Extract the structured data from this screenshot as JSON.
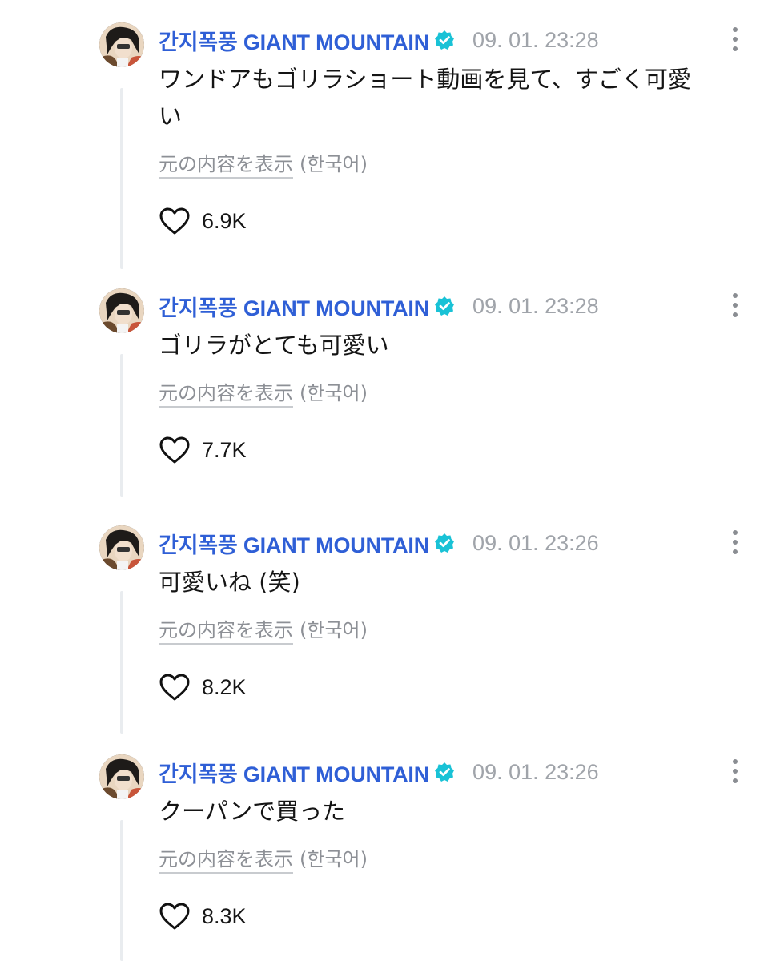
{
  "comments": [
    {
      "author": "간지폭풍 GIANT MOUNTAIN",
      "timestamp": "09. 01. 23:28",
      "text": "ワンドアもゴリラショート動画を見て、すごく可愛い",
      "show_original_label": "元の内容を表示",
      "language_label": "(한국어)",
      "likes": "6.9K"
    },
    {
      "author": "간지폭풍 GIANT MOUNTAIN",
      "timestamp": "09. 01. 23:28",
      "text": "ゴリラがとても可愛い",
      "show_original_label": "元の内容を表示",
      "language_label": "(한국어)",
      "likes": "7.7K"
    },
    {
      "author": "간지폭풍 GIANT MOUNTAIN",
      "timestamp": "09. 01. 23:26",
      "text": "可愛いね (笑)",
      "show_original_label": "元の内容を表示",
      "language_label": "(한국어)",
      "likes": "8.2K"
    },
    {
      "author": "간지폭풍 GIANT MOUNTAIN",
      "timestamp": "09. 01. 23:26",
      "text": "クーパンで買った",
      "show_original_label": "元の内容を表示",
      "language_label": "(한국어)",
      "likes": "8.3K"
    }
  ],
  "colors": {
    "author": "#2f5fd6",
    "verified_badge": "#19c2d6",
    "timestamp": "#a0a4aa",
    "muted_text": "#8d9096",
    "thread_line": "#e9ecef"
  },
  "icons": {
    "verified": "verified-badge-icon",
    "more": "more-vertical-icon",
    "like": "heart-outline-icon"
  }
}
